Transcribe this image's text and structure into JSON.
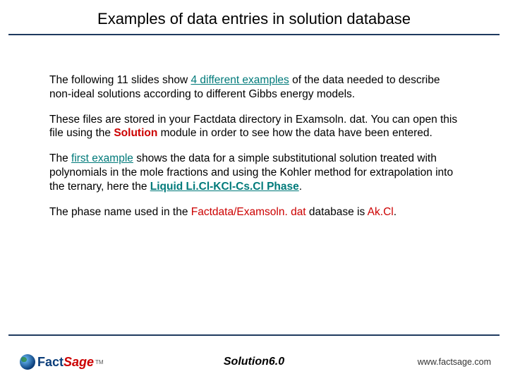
{
  "title": "Examples of data entries in solution database",
  "para1": {
    "t1": "The following 11 slides show ",
    "hl": "4 different examples",
    "t2": " of the data needed to describe non-ideal solutions according to different Gibbs energy models."
  },
  "para2": {
    "t1": "These files are stored in your Factdata directory in Examsoln. dat. You can open this file using the ",
    "hl": "Solution",
    "t2": " module in order to see how the data have been entered."
  },
  "para3": {
    "t1": "The ",
    "hl1": "first example",
    "t2": " shows the data for a simple substitutional solution treated with polynomials in the mole fractions and using the Kohler method for extrapolation into the ternary, here the ",
    "hl2": "Liquid Li.Cl-KCl-Cs.Cl Phase",
    "t3": "."
  },
  "para4": {
    "t1": "The phase name used in the ",
    "hl1": "Factdata/Examsoln. dat",
    "t2": " database is ",
    "hl2": "Ak.Cl",
    "t3": "."
  },
  "footer": {
    "logo_fact": "Fact",
    "logo_sage": "Sage",
    "logo_tm": "TM",
    "center": "Solution6.0",
    "url": "www.factsage.com"
  }
}
